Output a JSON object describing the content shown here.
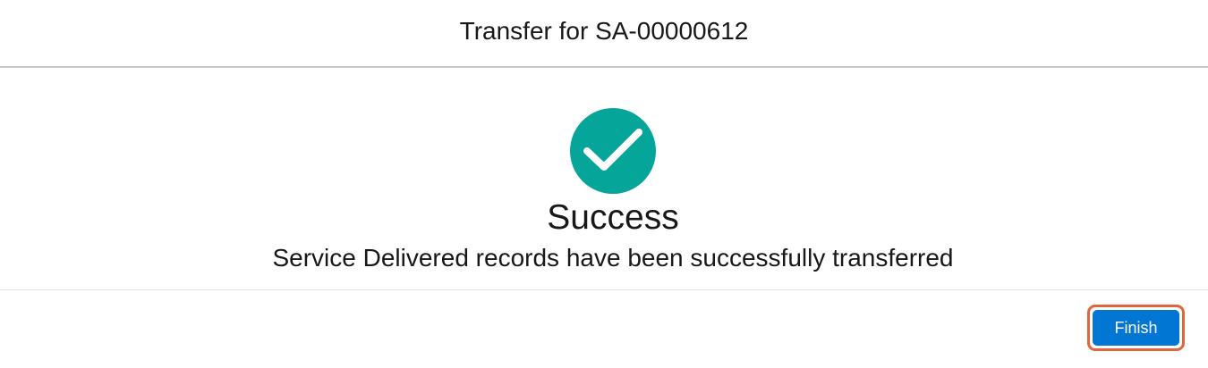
{
  "header": {
    "title": "Transfer for SA-00000612"
  },
  "body": {
    "icon": "checkmark-icon",
    "icon_color": "#06a59a",
    "title": "Success",
    "message": "Service Delivered records have been successfully transferred"
  },
  "footer": {
    "finish_label": "Finish",
    "button_color": "#0176d3",
    "highlight_color": "#e1653d"
  }
}
